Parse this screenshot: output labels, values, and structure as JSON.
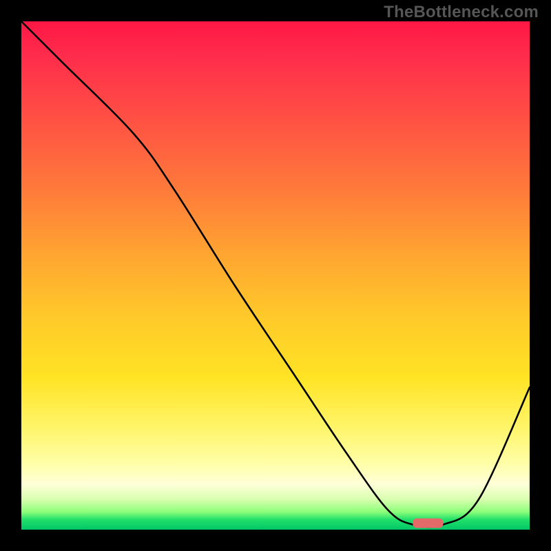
{
  "watermark": "TheBottleneck.com",
  "chart_data": {
    "type": "line",
    "title": "",
    "xlabel": "",
    "ylabel": "",
    "xlim": [
      0,
      100
    ],
    "ylim": [
      0,
      100
    ],
    "series": [
      {
        "name": "bottleneck-curve",
        "x": [
          0,
          8,
          22,
          30,
          42,
          54,
          64,
          72,
          77,
          83,
          90,
          100
        ],
        "y": [
          100,
          92,
          78,
          67,
          48,
          30,
          15,
          4,
          1,
          1,
          6,
          28
        ]
      }
    ],
    "marker": {
      "x_start": 77,
      "x_end": 83,
      "y": 1
    },
    "background_gradient": {
      "direction": "vertical",
      "stops": [
        {
          "pos": 0,
          "color": "#ff1744"
        },
        {
          "pos": 0.18,
          "color": "#ff4d45"
        },
        {
          "pos": 0.46,
          "color": "#ffa531"
        },
        {
          "pos": 0.7,
          "color": "#ffe324"
        },
        {
          "pos": 0.91,
          "color": "#ffffd8"
        },
        {
          "pos": 1.0,
          "color": "#00c766"
        }
      ]
    }
  }
}
